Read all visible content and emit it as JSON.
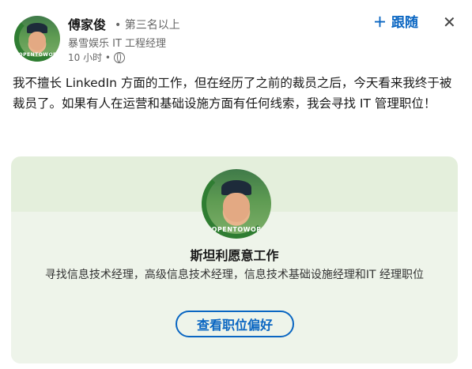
{
  "author": {
    "name": "傅家俊",
    "degree": "• 第三名以上",
    "headline": "暴雪娱乐 IT 工程经理",
    "time": "10 小时 •",
    "avatar_badge": "#OPENTOWORK"
  },
  "actions": {
    "follow_label": "跟随",
    "follow_icon": "plus-icon",
    "close_icon": "close-icon"
  },
  "post": {
    "text": "我不擅长 LinkedIn 方面的工作，但在经历了之前的裁员之后，今天看来我终于被裁员了。如果有人在运营和基础设施方面有任何线索，我会寻找 IT 管理职位！"
  },
  "open_to_work_card": {
    "title": "斯坦利愿意工作",
    "description": "寻找信息技术经理，高级信息技术经理，信息技术基础设施经理和IT 经理职位",
    "button_label": "查看职位偏好",
    "avatar_badge": "#OPENTOWORK"
  },
  "colors": {
    "accent": "#0a66c2",
    "card_bg": "#e4efdc",
    "badge_green": "#2f7d32"
  }
}
